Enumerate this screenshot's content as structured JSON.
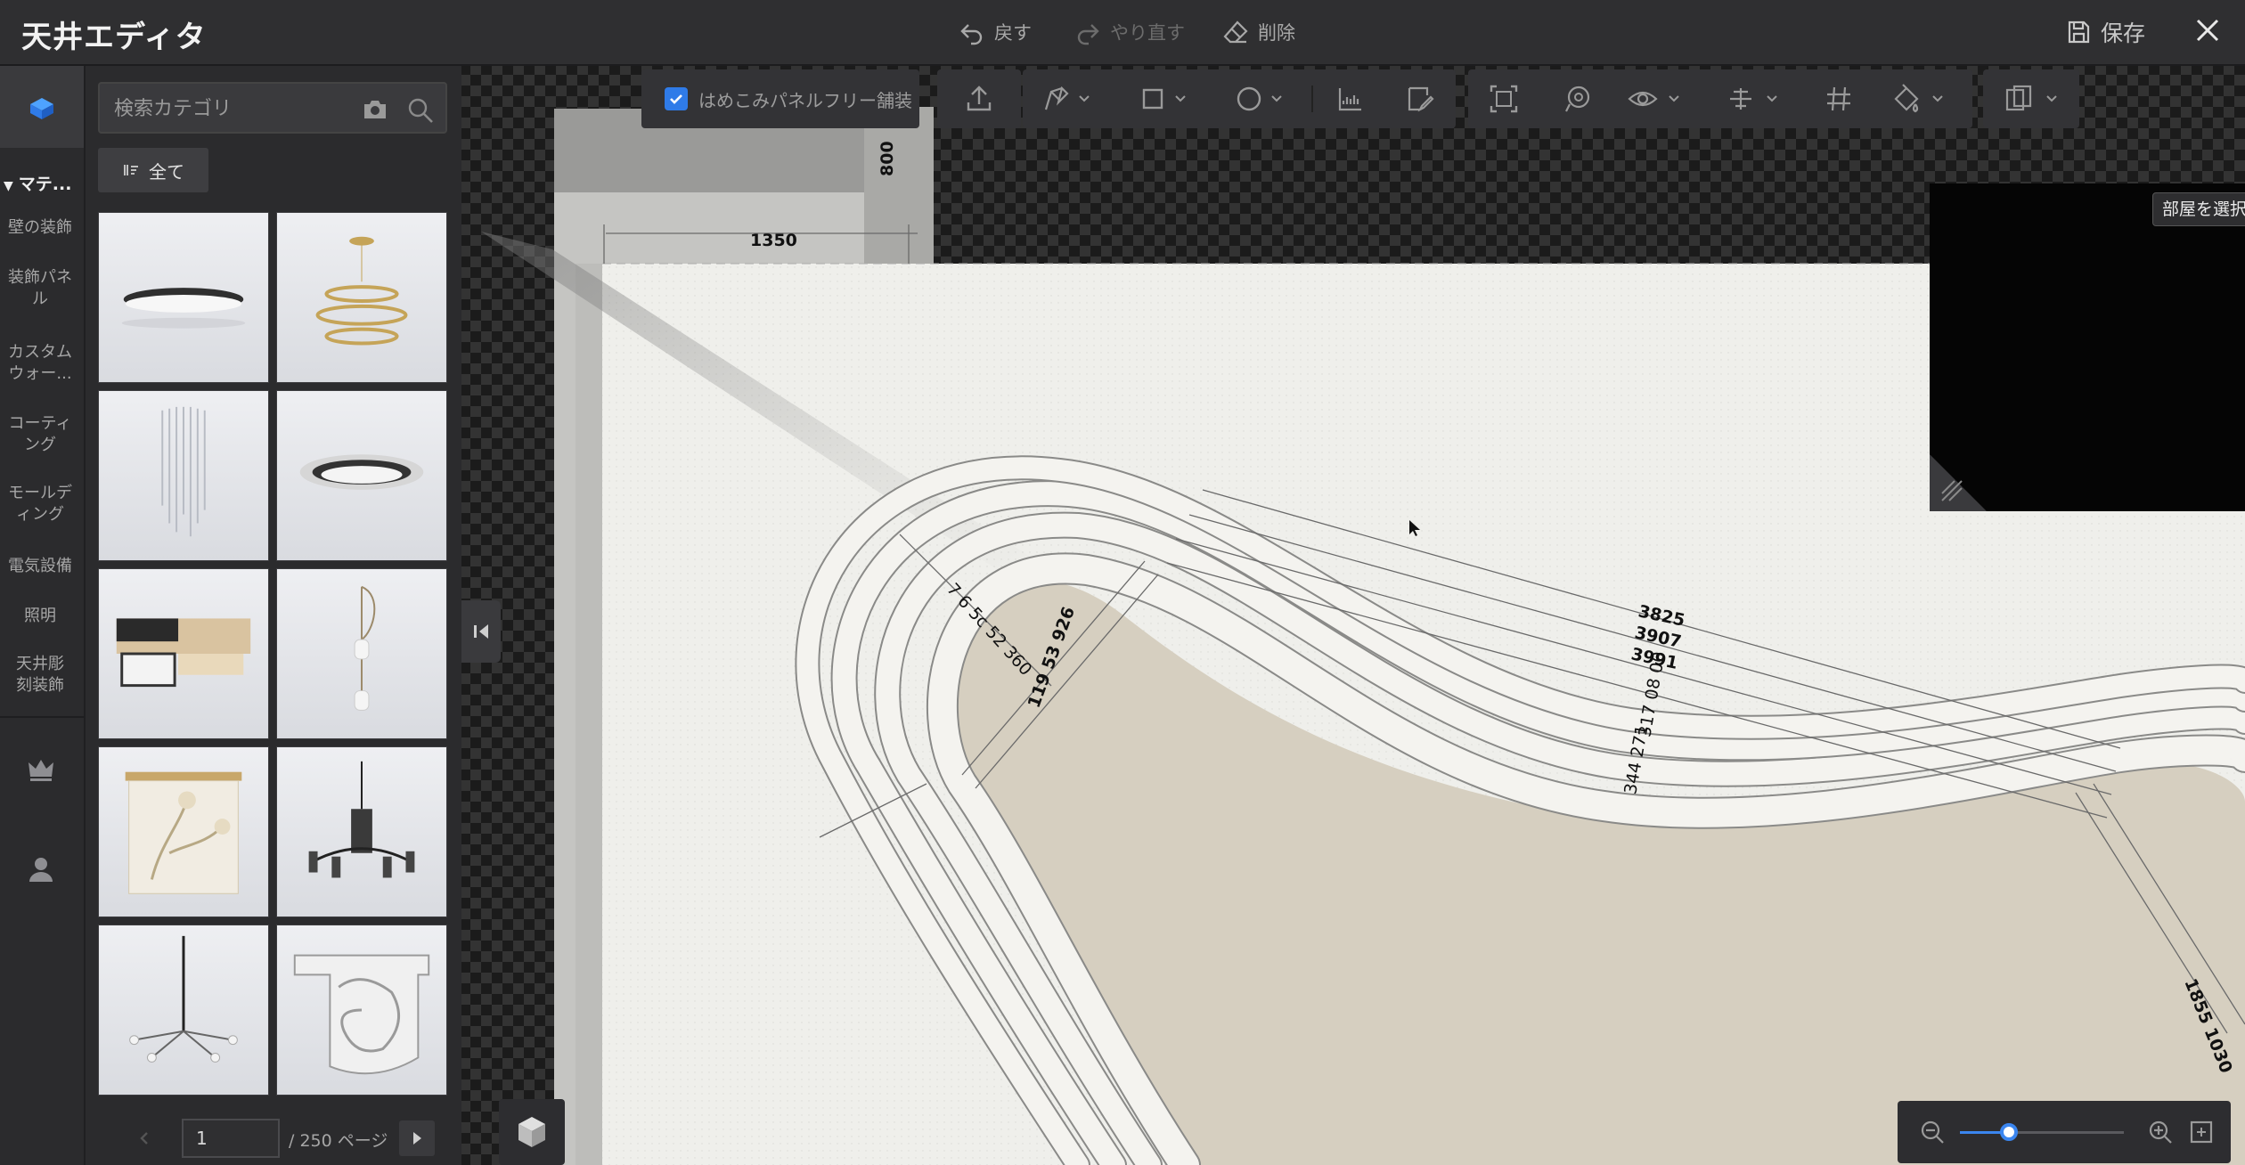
{
  "app": {
    "title": "天井エディタ"
  },
  "topbar": {
    "undo_label": "戻す",
    "redo_label": "やり直す",
    "delete_label": "削除",
    "save_label": "保存"
  },
  "sidebar": {
    "category_header": "マテ...",
    "items": [
      {
        "label": "壁の装飾"
      },
      {
        "label": "装飾パネル"
      },
      {
        "label": "カスタムウォー..."
      },
      {
        "label": "コーティング"
      },
      {
        "label": "モールディング"
      },
      {
        "label": "電気設備"
      },
      {
        "label": "照明"
      },
      {
        "label": "天井彫刻装飾"
      }
    ]
  },
  "catalog": {
    "search_placeholder": "検索カテゴリ",
    "filter_label": "全て",
    "items": [
      {
        "icon": "round-ceiling-light"
      },
      {
        "icon": "ring-pendant-light"
      },
      {
        "icon": "crystal-chandelier"
      },
      {
        "icon": "flush-mount-light"
      },
      {
        "icon": "wood-square-light"
      },
      {
        "icon": "pendant-lamp"
      },
      {
        "icon": "floral-drum-light"
      },
      {
        "icon": "black-chandelier"
      },
      {
        "icon": "sputnik-chandelier"
      },
      {
        "icon": "carved-corbel"
      }
    ]
  },
  "pagination": {
    "current_page": "1",
    "total_label": "/ 250 ページ"
  },
  "canvas": {
    "seamless_panel_label": "はめこみパネルフリー舗装",
    "room_select_label": "部屋を選択",
    "dimensions": {
      "d800": "800",
      "d1350": "1350",
      "d3825": "3825",
      "d3907": "3907",
      "d3991": "3991",
      "arc_left": "7 6 5c 52 360",
      "arc_mid_upper": "317 08 00",
      "arc_mid_lower": "344 271",
      "right_stack": "1855 1030",
      "left_stack": "119 53 926"
    },
    "zoom_level": 0.3
  },
  "colors": {
    "accent": "#2f7be8",
    "topbar_bg": "#2f2f31",
    "panel_bg": "#2b2b2d",
    "floor": "#d6cfc0",
    "ceiling": "#f0f0ec"
  }
}
